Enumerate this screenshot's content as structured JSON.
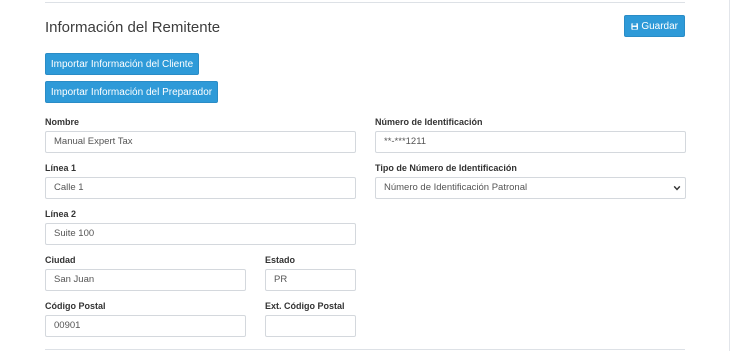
{
  "section": {
    "title": "Información del Remitente",
    "save_label": "Guardar",
    "import_client_label": "Importar Información del Cliente",
    "import_preparer_label": "Importar Información del Preparador"
  },
  "form": {
    "nombre": {
      "label": "Nombre",
      "value": "Manual Expert Tax"
    },
    "linea1": {
      "label": "Línea 1",
      "value": "Calle 1"
    },
    "linea2": {
      "label": "Línea 2",
      "value": "Suite 100"
    },
    "ciudad": {
      "label": "Ciudad",
      "value": "San Juan"
    },
    "estado": {
      "label": "Estado",
      "value": "PR"
    },
    "codigo_postal": {
      "label": "Código Postal",
      "value": "00901"
    },
    "ext_codigo_postal": {
      "label": "Ext. Código Postal",
      "value": ""
    },
    "numero_identificacion": {
      "label": "Número de Identificación",
      "value": "**-***1211"
    },
    "tipo_identificacion": {
      "label": "Tipo de Número de Identificación",
      "value": "Número de Identificación Patronal"
    }
  },
  "colors": {
    "primary_button": "#2e9ad8",
    "input_border": "#d4d8dd"
  },
  "icons": {
    "save": "floppy-disk-icon",
    "dropdown": "chevron-down-icon"
  }
}
